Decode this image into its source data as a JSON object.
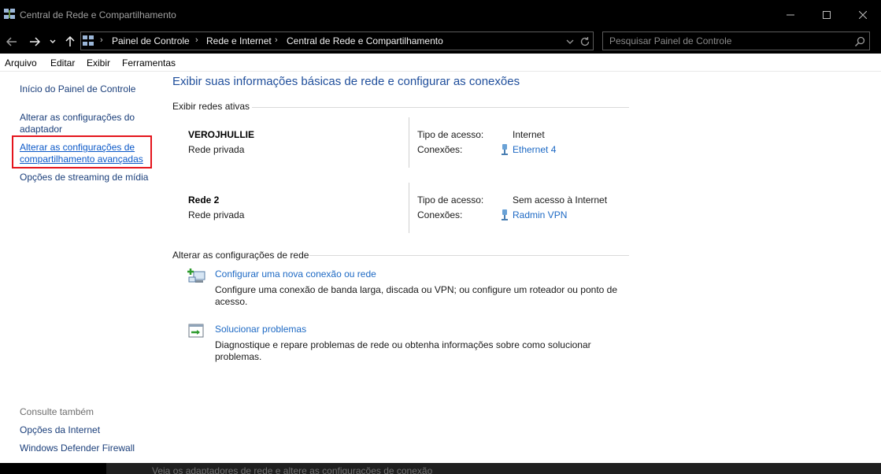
{
  "window": {
    "title": "Central de Rede e Compartilhamento",
    "icon": "network-center-icon"
  },
  "nav": {
    "breadcrumbs": [
      "Painel de Controle",
      "Rede e Internet",
      "Central de Rede e Compartilhamento"
    ],
    "search_placeholder": "Pesquisar Painel de Controle"
  },
  "menu": {
    "items": [
      "Arquivo",
      "Editar",
      "Exibir",
      "Ferramentas"
    ]
  },
  "sidebar": {
    "home": "Início do Painel de Controle",
    "adapter_line1": "Alterar as configurações do",
    "adapter_line2": "adaptador",
    "sharing_line1": "Alterar as configurações de",
    "sharing_line2": "compartilhamento avançadas",
    "streaming": "Opções de streaming de mídia",
    "see_also_title": "Consulte também",
    "see_also": [
      "Opções da Internet",
      "Windows Defender Firewall"
    ]
  },
  "main": {
    "title": "Exibir suas informações básicas de rede e configurar as conexões",
    "active_networks_header": "Exibir redes ativas",
    "networks": [
      {
        "name": "VEROJHULLIE",
        "category": "Rede privada",
        "access_label": "Tipo de acesso:",
        "access_value": "Internet",
        "connections_label": "Conexões:",
        "connection": "Ethernet 4"
      },
      {
        "name": "Rede 2",
        "category": "Rede privada",
        "access_label": "Tipo de acesso:",
        "access_value": "Sem acesso à Internet",
        "connections_label": "Conexões:",
        "connection": "Radmin VPN"
      }
    ],
    "change_settings_header": "Alterar as configurações de rede",
    "tasks": [
      {
        "link": "Configurar uma nova conexão ou rede",
        "desc_line1": "Configure uma conexão de banda larga, discada ou VPN; ou configure um roteador ou ponto de",
        "desc_line2": "acesso."
      },
      {
        "link": "Solucionar problemas",
        "desc_line1": "Diagnostique e repare problemas de rede ou obtenha informações sobre como solucionar",
        "desc_line2": "problemas."
      }
    ]
  },
  "status": {
    "partial_text": "Veja os adaptadores de rede e altere as configurações de conexão"
  },
  "colors": {
    "highlight": "#e4141c",
    "link": "#1d69c4",
    "title": "#1f4e9b"
  }
}
